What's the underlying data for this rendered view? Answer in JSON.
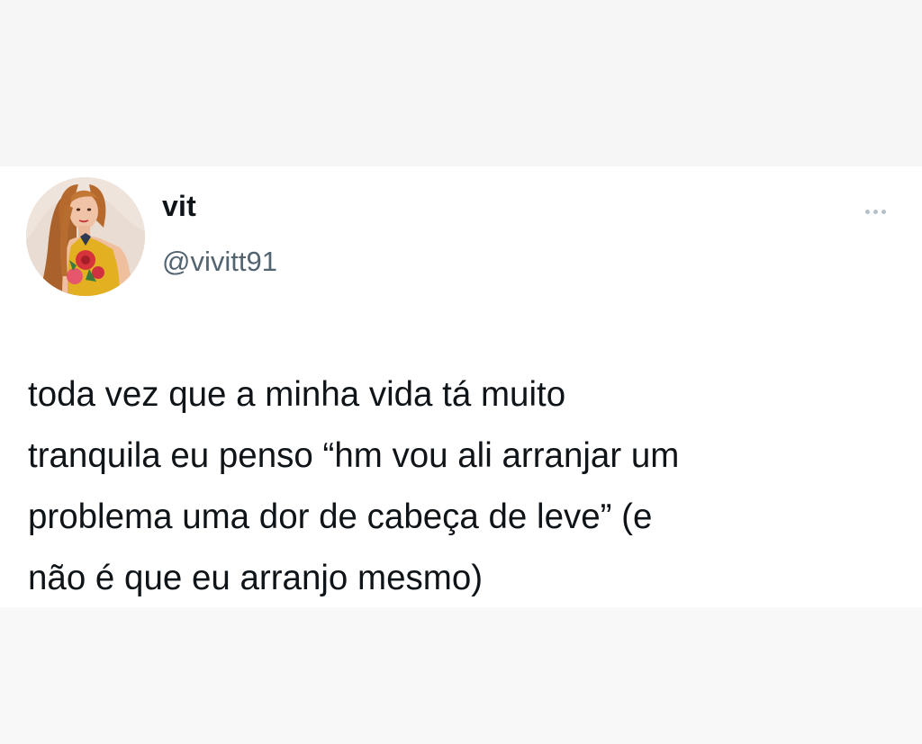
{
  "tweet": {
    "author": {
      "display_name": "vit",
      "handle": "@vivitt91",
      "avatar_icon": "profile-photo"
    },
    "more_icon": "ellipsis-icon",
    "text": "toda vez que a minha vida tá muito\ntranquila eu penso “hm vou ali arranjar  um\nproblema uma dor de cabeça de leve” (e\nnão é que eu arranjo mesmo)"
  },
  "colors": {
    "text_primary": "#0f1419",
    "text_secondary": "#536471",
    "card_background": "#ffffff",
    "page_background": "#f7f7f7"
  }
}
